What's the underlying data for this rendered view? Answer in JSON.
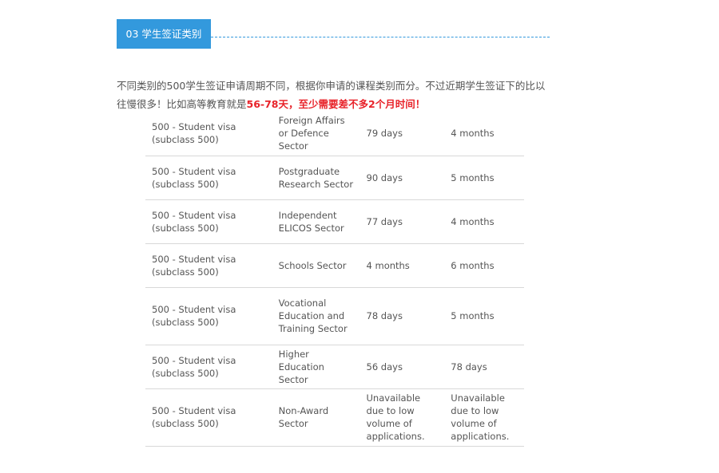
{
  "section": {
    "tag": "03 学生签证类别"
  },
  "intro": {
    "text_before": "不同类别的500学生签证申请周期不同，根据你申请的课程类别而分。不过近期学生签证下的比以往慢很多！比如高等教育就是",
    "highlight": "56-78天，至少需要差不多2个月时间！"
  },
  "table": {
    "rows": [
      {
        "visa": "500 - Student visa (subclass 500)",
        "sector": "Foreign Affairs or Defence Sector",
        "time_a": "79 days",
        "time_b": "4 months"
      },
      {
        "visa": "500 - Student visa (subclass 500)",
        "sector": "Postgraduate Research Sector",
        "time_a": "90 days",
        "time_b": "5 months"
      },
      {
        "visa": "500 - Student visa (subclass 500)",
        "sector": "Independent ELICOS Sector",
        "time_a": "77 days",
        "time_b": "4 months"
      },
      {
        "visa": "500 - Student visa (subclass 500)",
        "sector": "Schools Sector",
        "time_a": "4 months",
        "time_b": "6 months"
      },
      {
        "visa": "500 - Student visa (subclass 500)",
        "sector": "Vocational Education and Training Sector",
        "time_a": "78 days",
        "time_b": "5 months"
      },
      {
        "visa": "500 - Student visa (subclass 500)",
        "sector": "Higher Education Sector",
        "time_a": "56 days",
        "time_b": "78 days"
      },
      {
        "visa": "500 - Student visa (subclass 500)",
        "sector": "Non-Award Sector",
        "time_a": "Unavailable due to low volume of applications.",
        "time_b": "Unavailable due to low volume of applications."
      }
    ]
  },
  "colors": {
    "accent": "#3399dd",
    "highlight": "#e8232a",
    "text": "#555555",
    "rule": "#d8d8d8"
  }
}
